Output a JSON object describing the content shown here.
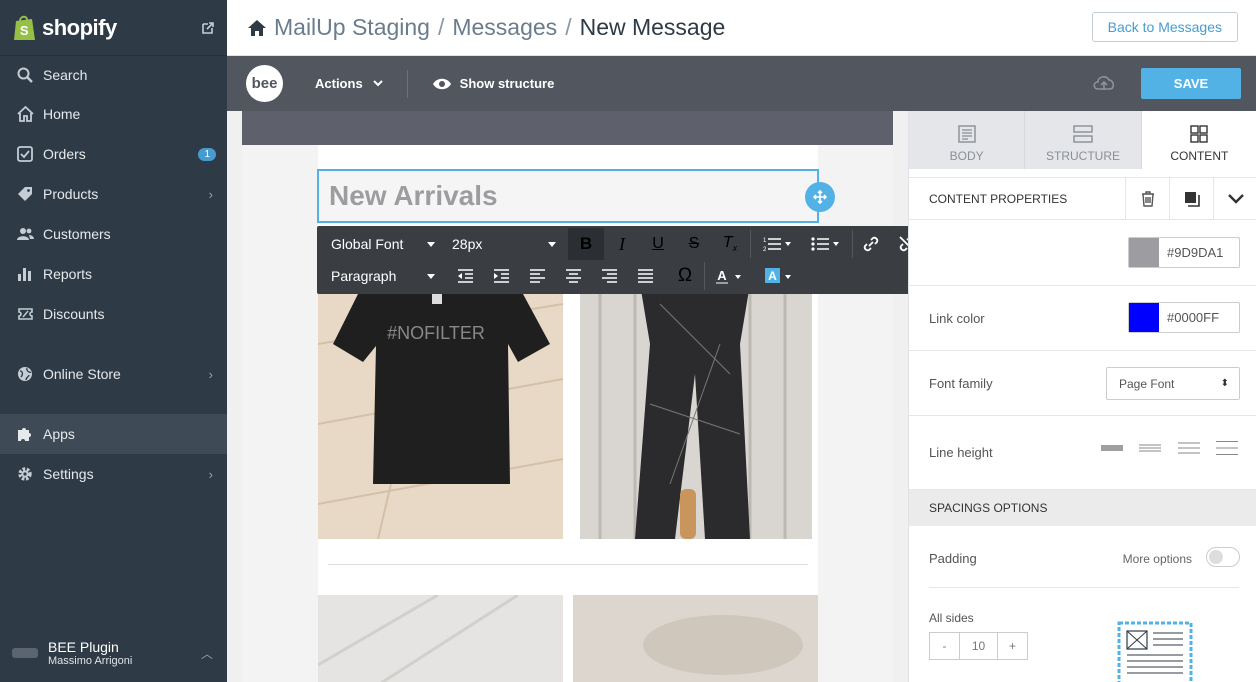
{
  "sidebar": {
    "brand": "shopify",
    "items": [
      {
        "label": "Search",
        "icon": "search-icon"
      },
      {
        "label": "Home",
        "icon": "home-icon"
      },
      {
        "label": "Orders",
        "icon": "orders-icon",
        "badge": "1"
      },
      {
        "label": "Products",
        "icon": "tag-icon",
        "chevron": true
      },
      {
        "label": "Customers",
        "icon": "customers-icon"
      },
      {
        "label": "Reports",
        "icon": "reports-icon"
      },
      {
        "label": "Discounts",
        "icon": "discounts-icon"
      },
      {
        "label": "Online Store",
        "icon": "globe-icon",
        "chevron": true
      },
      {
        "label": "Apps",
        "icon": "puzzle-icon",
        "active": true
      },
      {
        "label": "Settings",
        "icon": "gear-icon",
        "chevron": true
      }
    ],
    "footer": {
      "app_name": "BEE Plugin",
      "user_name": "Massimo Arrigoni"
    }
  },
  "header": {
    "crumbs": [
      "MailUp Staging",
      "/",
      "Messages",
      "/",
      "New Message"
    ],
    "back_label": "Back to Messages"
  },
  "toolbar": {
    "logo": "bee",
    "actions_label": "Actions",
    "show_structure_label": "Show structure",
    "save_label": "SAVE"
  },
  "editor": {
    "heading_text": "New Arrivals",
    "shirt_print": "#NOFILTER",
    "text_toolbar": {
      "font": "Global Font",
      "size": "28px",
      "block": "Paragraph",
      "omega": "Ω"
    }
  },
  "panel": {
    "tabs": [
      {
        "label": "BODY",
        "icon": "body-icon"
      },
      {
        "label": "STRUCTURE",
        "icon": "structure-icon"
      },
      {
        "label": "CONTENT",
        "icon": "content-icon",
        "active": true
      }
    ],
    "props_title": "CONTENT PROPERTIES",
    "text_color": {
      "hex": "#9D9DA1"
    },
    "link_color": {
      "label": "Link color",
      "hex": "#0000FF"
    },
    "font_family": {
      "label": "Font family",
      "value": "Page Font"
    },
    "line_height": {
      "label": "Line height"
    },
    "spacings_title": "SPACINGS OPTIONS",
    "padding": {
      "label": "Padding",
      "more_options": "More options"
    },
    "all_sides": {
      "label": "All sides",
      "minus": "-",
      "value": "10",
      "plus": "+"
    }
  },
  "colors": {
    "sidebar_bg": "#2e3a45",
    "accent": "#52b2e6",
    "toolbar_bg": "#51565f",
    "heading_color": "#9D9DA1",
    "link_color": "#0000FF"
  }
}
